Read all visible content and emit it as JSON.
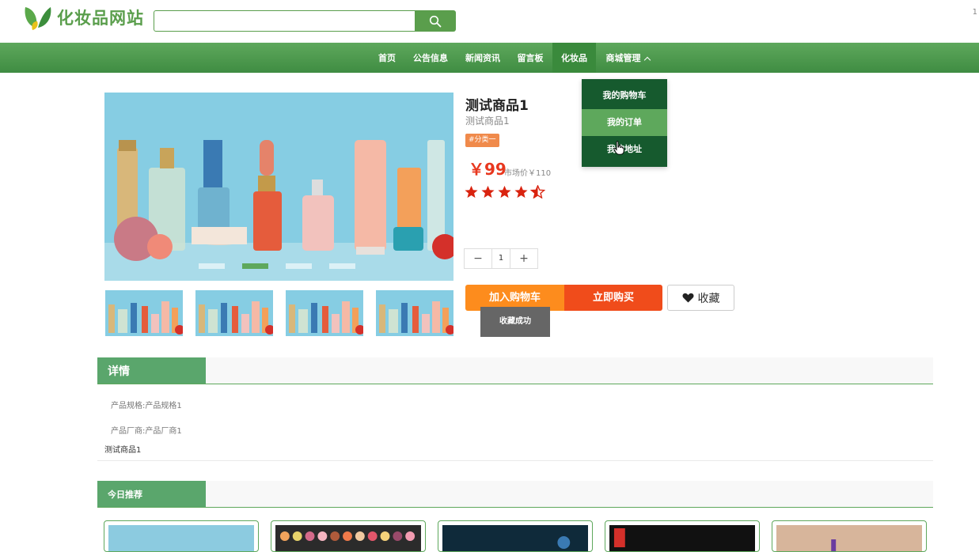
{
  "header": {
    "site_name": "化妆品网站",
    "search_placeholder": "",
    "corner_text": "1"
  },
  "nav": {
    "items": [
      "首页",
      "公告信息",
      "新闻资讯",
      "留言板",
      "化妆品",
      "商城管理"
    ],
    "active": "化妆品"
  },
  "dropdown": {
    "items": [
      "我的购物车",
      "我的订单",
      "我的地址"
    ],
    "hovered": "我的订单"
  },
  "product": {
    "title": "测试商品1",
    "subtitle": "测试商品1",
    "tag": "#分类一",
    "price": "￥99",
    "market_price": "市场价￥110",
    "rating": 4.5,
    "quantity": "1",
    "qty_minus": "−",
    "qty_plus": "+",
    "add_to_cart": "加入购物车",
    "buy_now": "立即购买",
    "favorite": "收藏",
    "toast": "收藏成功"
  },
  "carousel": {
    "slide_count": 4,
    "active_index": 1,
    "thumbnail_count": 4
  },
  "details": {
    "tab": "详情",
    "specs": [
      "产品规格:产品规格1",
      "产品厂商:产品厂商1"
    ],
    "description": "测试商品1"
  },
  "recommend": {
    "tab": "今日推荐",
    "card_count": 5
  },
  "colors": {
    "brand_green": "#5ea85c",
    "dropdown_bg": "#165a2e",
    "cart_orange": "#fd8c1d",
    "buy_red": "#f04c1b",
    "price_red": "#e8371e",
    "star_red": "#d9230f"
  },
  "icons": {
    "search": "search-icon",
    "heart": "heart-icon",
    "leaf_logo": "leaf-logo-icon",
    "star": "star-icon"
  }
}
